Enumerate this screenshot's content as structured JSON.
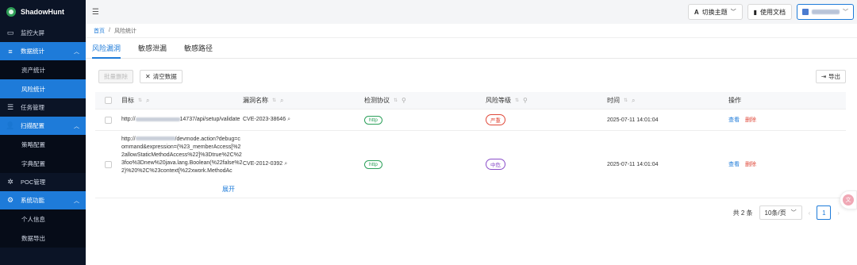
{
  "brand": {
    "name": "ShadowHunt"
  },
  "sidebar": {
    "items": [
      {
        "label": "监控大屏",
        "icon": "monitor-icon"
      },
      {
        "label": "数据统计",
        "icon": "database-icon",
        "open": true
      },
      {
        "label": "资产统计",
        "sub": true
      },
      {
        "label": "风险统计",
        "sub": true,
        "active": true
      },
      {
        "label": "任务管理",
        "icon": "tasks-icon"
      },
      {
        "label": "扫描配置",
        "icon": "user-config-icon",
        "open": true
      },
      {
        "label": "策略配置",
        "sub": true
      },
      {
        "label": "字典配置",
        "sub": true
      },
      {
        "label": "POC管理",
        "icon": "bug-icon"
      },
      {
        "label": "系统功能",
        "icon": "gear-icon",
        "open": true
      },
      {
        "label": "个人信息",
        "sub": true
      },
      {
        "label": "数据导出",
        "sub": true
      }
    ]
  },
  "topbar": {
    "theme_label": "切换主题",
    "docs_label": "使用文档"
  },
  "breadcrumb": {
    "home": "首页",
    "separator": "/",
    "current": "风险统计"
  },
  "tabs": [
    {
      "label": "风险漏洞",
      "active": true
    },
    {
      "label": "敏感泄漏"
    },
    {
      "label": "敏感路径"
    }
  ],
  "toolbar": {
    "batch_delete": "批量删除",
    "clear_data": "清空数据",
    "export": "导出"
  },
  "table": {
    "headers": {
      "target": "目标",
      "name": "漏洞名称",
      "protocol": "检测协议",
      "level": "风险等级",
      "time": "时间",
      "ops": "操作"
    },
    "rows": [
      {
        "target_prefix": "http://",
        "target_suffix": "14737/api/setup/validate",
        "name": "CVE-2023-38646",
        "protocol": "http",
        "level": "严重",
        "time": "2025-07-11 14:01:04",
        "view": "查看",
        "del": "删除"
      },
      {
        "target_prefix": "http://",
        "target_suffix": "/devmode.action?debug=command&expression=(%23_memberAccess[%22allowStaticMethodAccess%22]%3Dtrue%2C%23foo%3Dnew%20java.lang.Boolean(%22false%22)%20%2C%23context[%22xwork.MethodAc",
        "name": "CVE-2012-0392",
        "protocol": "http",
        "level": "中危",
        "time": "2025-07-11 14:01:04",
        "view": "查看",
        "del": "删除",
        "expand": "展开"
      }
    ]
  },
  "pagination": {
    "total": "共 2 条",
    "page_size": "10条/页",
    "current_page": "1"
  },
  "colors": {
    "accent": "#1e7bd9",
    "sidebar_bg": "#0b1426",
    "critical": "#e0493a",
    "medium": "#8a4ec9",
    "protocol": "#2ca05a"
  }
}
